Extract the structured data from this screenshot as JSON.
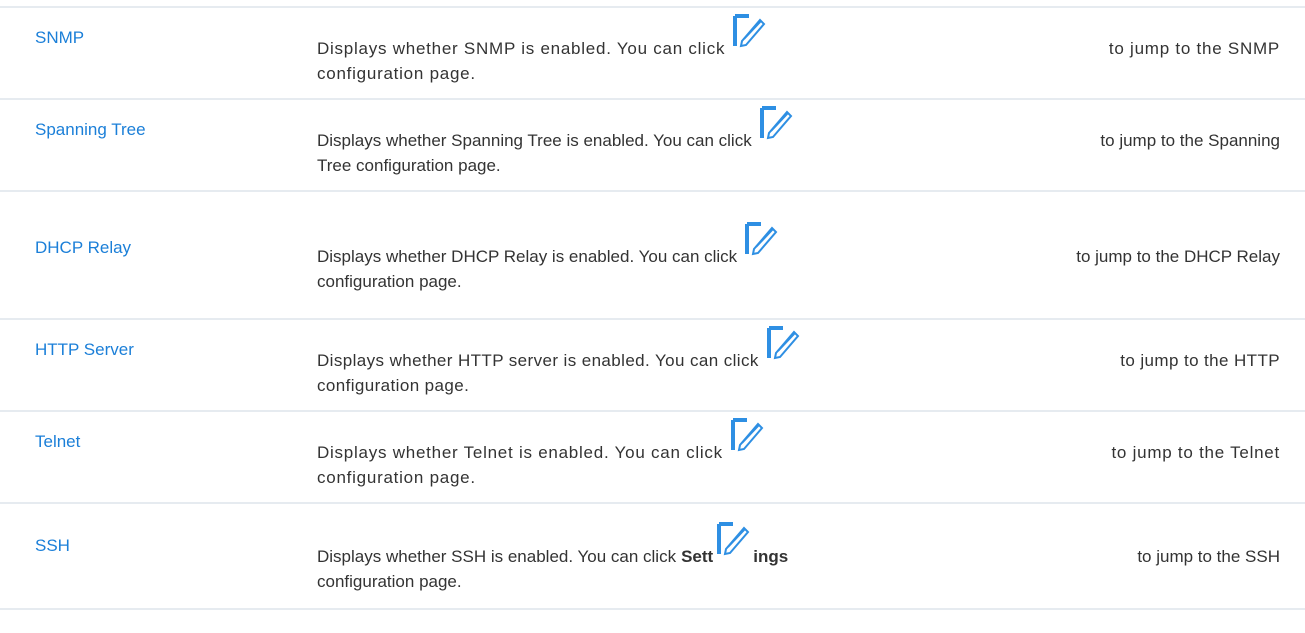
{
  "rows": [
    {
      "term": "SNMP",
      "line1_before": "Displays whether SNMP is enabled. You can click",
      "line1_after": "to jump to the SNMP",
      "line2": "configuration page."
    },
    {
      "term": "Spanning Tree",
      "line1_before": "Displays whether Spanning Tree is enabled. You can click",
      "line1_after": "to jump to the Spanning",
      "line2": "Tree configuration page."
    },
    {
      "term": "DHCP Relay",
      "line1_before": "Displays whether DHCP Relay is enabled. You can click",
      "line1_after": "to jump to the DHCP Relay",
      "line2": "configuration page."
    },
    {
      "term": "HTTP Server",
      "line1_before": "Displays whether HTTP server is enabled. You can click",
      "line1_after": "to jump to the HTTP",
      "line2": "configuration page."
    },
    {
      "term": "Telnet",
      "line1_before": "Displays whether Telnet is enabled. You can click",
      "line1_after": "to jump to the Telnet",
      "line2": "configuration page."
    },
    {
      "term": "SSH",
      "line1_before": "Displays whether SSH is enabled. You can click",
      "bold_before": "Sett",
      "bold_after": "ings",
      "line1_after": "to jump to the SSH",
      "line2": "configuration page."
    }
  ],
  "colors": {
    "term": "#1b7fd8",
    "icon": "#2e8fe3",
    "divider": "#e6ebf0"
  },
  "icon_name": "edit-icon"
}
